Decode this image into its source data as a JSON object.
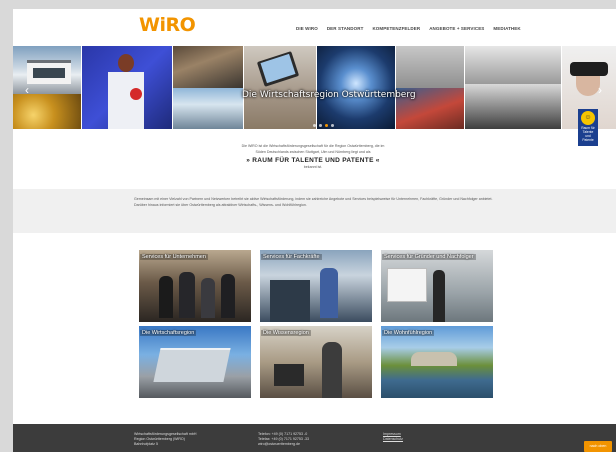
{
  "header": {
    "logo": "WiRO",
    "nav": [
      "Die WiRO",
      "Der Standort",
      "Kompetenzfelder",
      "Angebote + Services",
      "Mediathek"
    ]
  },
  "hero": {
    "caption": "Die Wirtschaftsregion Ostwürttemberg",
    "badge_text": [
      "Raum für",
      "Talente",
      "und",
      "Patente"
    ]
  },
  "intro": {
    "line1": "Die WiRO ist die Wirtschaftsförderungsgesellschaft für die Region Ostwürttemberg, die im",
    "line2": "Süden Deutschlands zwischen Stuttgart, Ulm und Nürnberg liegt und als",
    "kicker": "» RAUM FÜR TALENTE UND PATENTE «",
    "line3": "bekannt ist."
  },
  "band": {
    "text": "Gemeinsam mit einer Vielzahl von Partnern und Netzwerken betreibt sie aktive Wirtschaftsförderung, indem sie zahlreiche Angebote und Services beispielsweise für Unternehmen, Fachkräfte, Gründer und Nachfolger anbietet. Darüber hinaus informiert sie über Ostwürttemberg als attraktiver Wirtschafts-, Wissens- und Wohlfühlregion."
  },
  "cards": [
    {
      "title": "Services für Unternehmen"
    },
    {
      "title": "Services für Fachkräfte"
    },
    {
      "title": "Services für Gründer und Nachfolger"
    },
    {
      "title": "Die Wirtschaftsregion"
    },
    {
      "title": "Die Wissensregion"
    },
    {
      "title": "Die Wohnfühlregion"
    }
  ],
  "footer": {
    "address": [
      "Wirtschaftsförderungsgesellschaft mbH",
      "Region Ostwürttemberg (WiRO)",
      "Bahnhofplatz 5"
    ],
    "contact": [
      "Telefon: +49 (0) 7171 92753 -0",
      "Telefax: +49 (0) 7171 92753 -33",
      "wiro@ostwuerttemberg.de"
    ],
    "links": [
      "Impressum",
      "Datenschutz"
    ],
    "to_top": "nach oben"
  },
  "colors": {
    "brand": "#f29400",
    "footer_bg": "#3c3c3c",
    "band_bg": "#f0f0f0"
  }
}
